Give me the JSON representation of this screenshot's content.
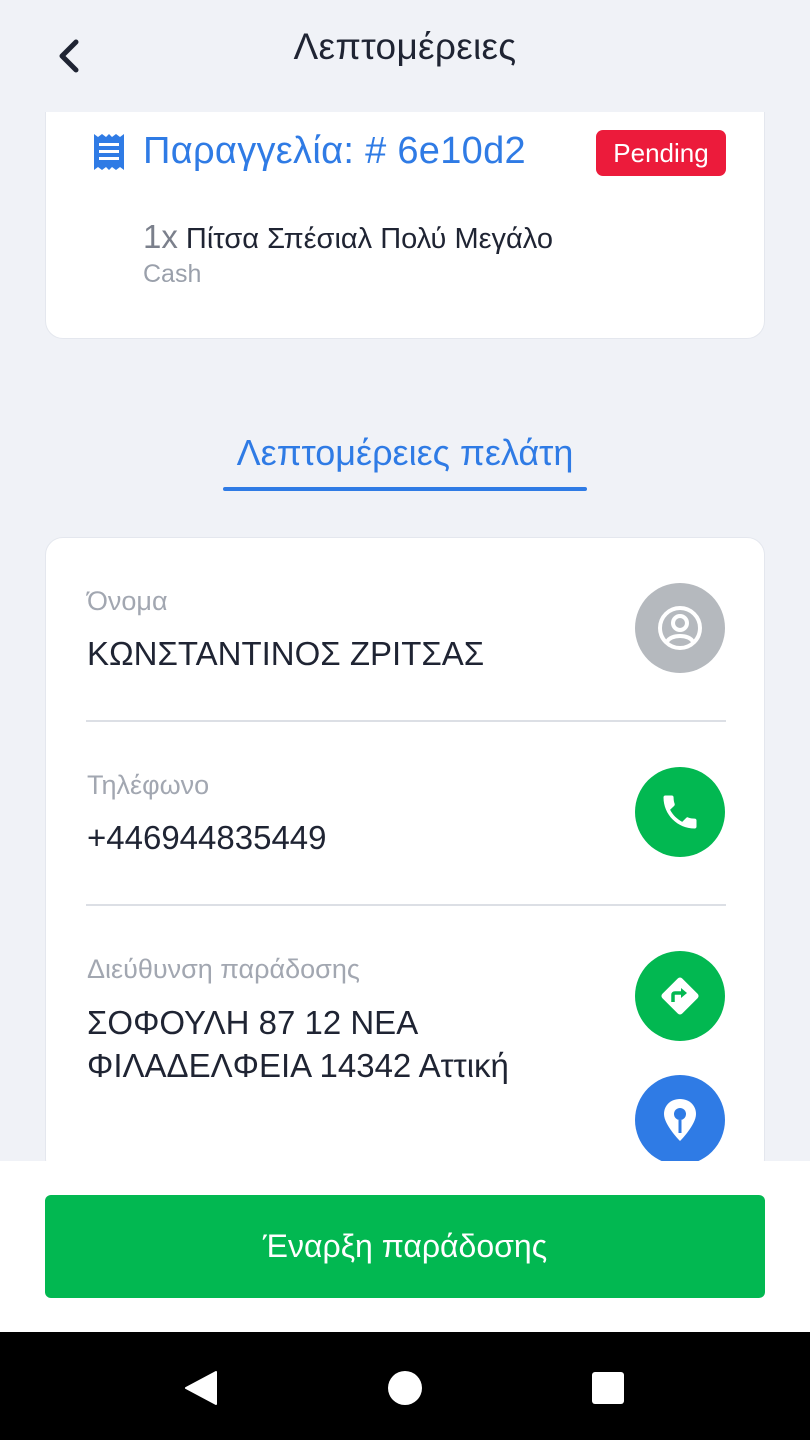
{
  "header": {
    "title": "Λεπτομέρειες"
  },
  "order": {
    "title": "Παραγγελία: # 6e10d2",
    "status": "Pending",
    "item_qty": "1x",
    "item_name": "Πίτσα Σπέσιαλ Πολύ Μεγάλο",
    "payment": "Cash"
  },
  "section_tab": {
    "label": "Λεπτομέρειες πελάτη"
  },
  "customer": {
    "name_label": "Όνομα",
    "name_value": "ΚΩΝΣΤΑΝΤΙΝΟΣ ΖΡΙΤΣΑΣ",
    "phone_label": "Τηλέφωνο",
    "phone_value": "+446944835449",
    "address_label": "Διεύθυνση παράδοσης",
    "address_line1": "ΣΟΦΟΥΛΗ 87 12 ΝΕΑ",
    "address_line2": "ΦΙΛΑΔΕΛΦΕΙΑ 14342 Αττική"
  },
  "actions": {
    "start_delivery": "Έναρξη παράδοσης"
  },
  "icons": {
    "back": "chevron-left-icon",
    "order": "receipt-icon",
    "profile": "user-circle-icon",
    "phone": "phone-icon",
    "directions": "directions-icon",
    "map_pin": "map-pin-icon"
  },
  "colors": {
    "accent_blue": "#2f7be5",
    "status_red": "#ec1b3b",
    "green": "#02b851",
    "gray_button": "#b5b9be",
    "background": "#f0f2f7"
  }
}
